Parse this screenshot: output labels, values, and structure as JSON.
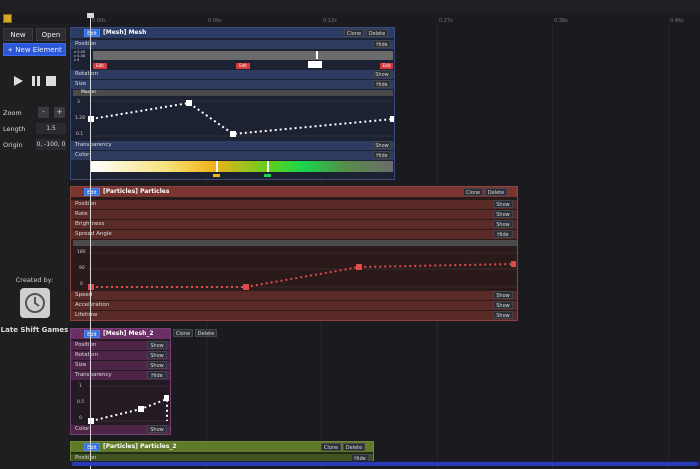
{
  "sidebar": {
    "new_label": "New",
    "open_label": "Open",
    "new_element_label": "+ New Element",
    "zoom_label": "Zoom",
    "zoom_minus": "-",
    "zoom_plus": "+",
    "length_label": "Length",
    "length_value": "1.5",
    "origin_label": "Origin",
    "origin_value": "0, -100, 0",
    "created_by": "Created by:",
    "studio_name": "Late Shift Games"
  },
  "ruler": {
    "ticks": [
      "0.00s",
      "0.06s",
      "0.12s",
      "0.27s",
      "0.38s",
      "0.46s"
    ]
  },
  "panels": {
    "mesh": {
      "edit": "Edit",
      "title": "[Mesh] Mesh",
      "clone": "Clone",
      "delete": "Delete",
      "position": "Position",
      "position_btn": "Hide",
      "pos_key1": "Edit",
      "pos_key2": "Edit",
      "pos_key3": "Edit",
      "pos_labels": [
        "x 0.40",
        "y 0.48",
        "z 0"
      ],
      "rotation": "Rotation",
      "rotation_btn": "Show",
      "size": "Size",
      "size_btn": "Hide",
      "size_header": "Master",
      "size_ylabels": [
        "3",
        "1.28",
        "0.1"
      ],
      "transparency": "Transparency",
      "transparency_btn": "Show",
      "color": "Color",
      "color_btn": "Hide"
    },
    "particles": {
      "edit": "Edit",
      "title": "[Particles] Particles",
      "clone": "Clone",
      "delete": "Delete",
      "rows": [
        {
          "label": "Position",
          "btn": "Show"
        },
        {
          "label": "Rate",
          "btn": "Show"
        },
        {
          "label": "Brightness",
          "btn": "Show"
        },
        {
          "label": "Spread Angle",
          "btn": "Hide"
        }
      ],
      "curve_ylabels": [
        "180",
        "90",
        "0"
      ],
      "rows_after": [
        {
          "label": "Speed",
          "btn": "Show"
        },
        {
          "label": "Acceleration",
          "btn": "Show"
        },
        {
          "label": "Lifetime",
          "btn": "Show"
        }
      ]
    },
    "mesh2": {
      "edit": "Edit",
      "title": "[Mesh] Mesh_2",
      "clone": "Clone",
      "delete": "Delete",
      "rows": [
        {
          "label": "Position",
          "btn": "Show"
        },
        {
          "label": "Rotation",
          "btn": "Show"
        },
        {
          "label": "Size",
          "btn": "Show"
        },
        {
          "label": "Transparency",
          "btn": "Hide"
        }
      ],
      "curve_ylabels": [
        "1",
        "0.5",
        "0"
      ],
      "color": "Color",
      "color_btn": "Show"
    },
    "particles2": {
      "edit": "Edit",
      "title": "[Particles] Particles_2",
      "clone": "Clone",
      "delete": "Delete",
      "position": "Position",
      "position_btn": "Hide"
    }
  },
  "colors": {
    "mesh": "#2a3b66",
    "particles": "#7a3530",
    "mesh2": "#6a2f64",
    "particles2": "#5f7a28",
    "accent": "#2b57d9"
  }
}
